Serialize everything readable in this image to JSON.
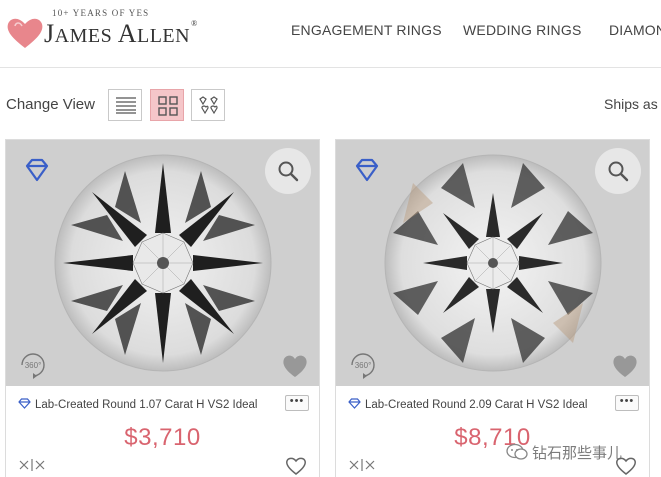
{
  "header": {
    "logo": {
      "tagline": "10+ YEARS OF YES",
      "name_first_initial": "J",
      "name_first_rest": "AMES ",
      "name_last_initial": "A",
      "name_last_rest": "LLEN",
      "registered": "®",
      "heart_color": "#e8868c"
    },
    "nav": [
      {
        "label": "ENGAGEMENT RINGS"
      },
      {
        "label": "WEDDING RINGS"
      },
      {
        "label": "DIAMON"
      }
    ]
  },
  "toolbar": {
    "change_view_label": "Change View",
    "views": [
      {
        "icon": "list-view-icon",
        "active": false
      },
      {
        "icon": "grid-view-icon",
        "active": true
      },
      {
        "icon": "gallery-view-icon",
        "active": false
      }
    ],
    "ships_label": "Ships as"
  },
  "products": [
    {
      "title": "Lab-Created Round 1.07 Carat H VS2 Ideal",
      "price": "$3,710",
      "more_label": "•••",
      "rotate_label": "360°"
    },
    {
      "title": "Lab-Created Round 2.09 Carat H VS2 Ideal",
      "price": "$8,710",
      "more_label": "•••",
      "rotate_label": "360°"
    }
  ],
  "watermark": {
    "text": "钻石那些事儿"
  },
  "colors": {
    "accent_pink": "#f5c6c9",
    "price_red": "#d9646f",
    "gem_blue": "#3a5fc8"
  }
}
